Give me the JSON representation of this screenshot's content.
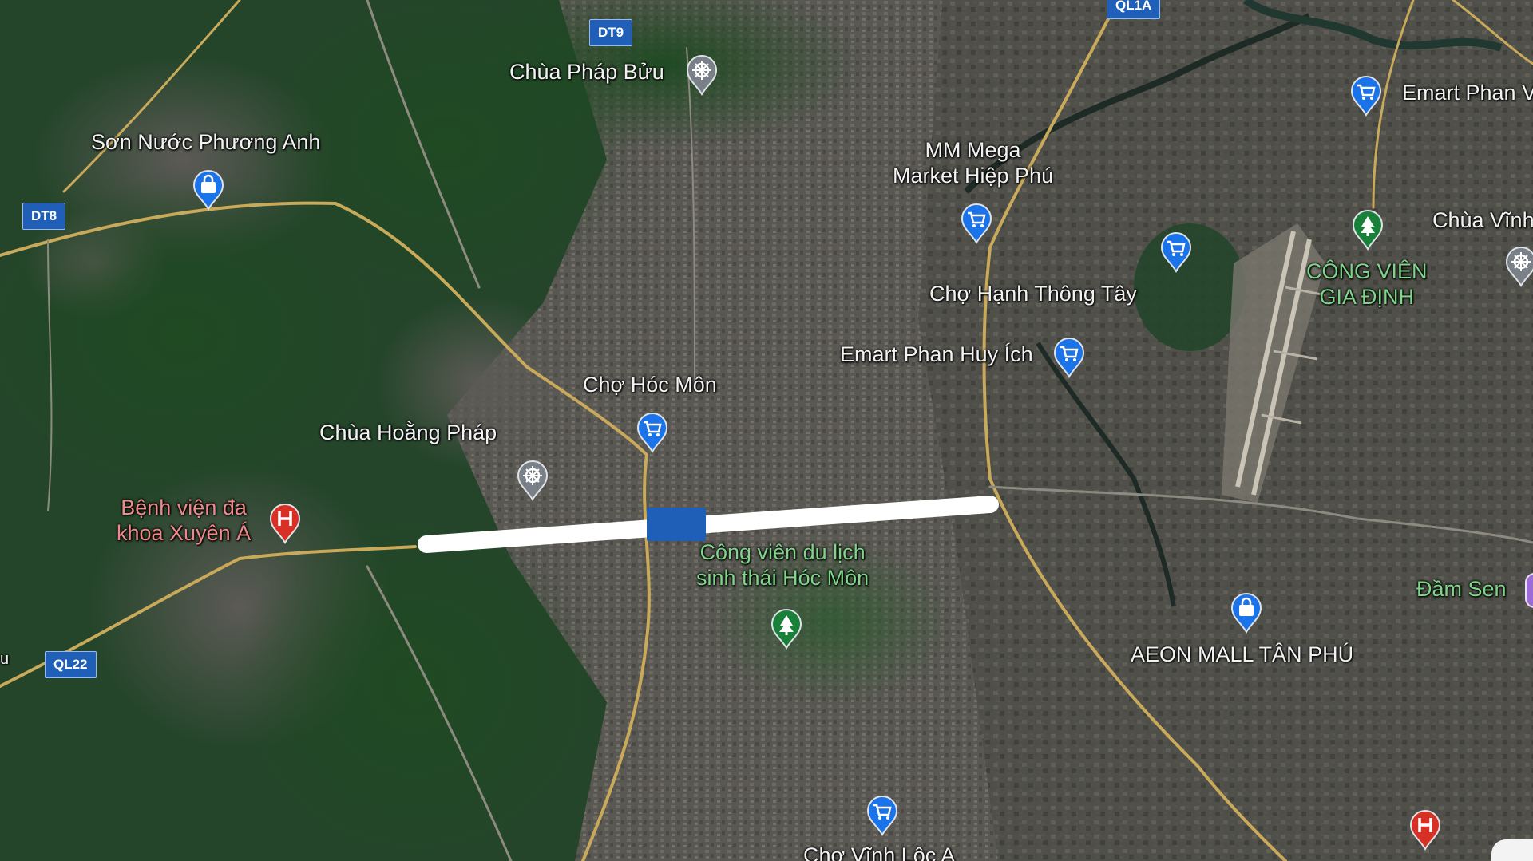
{
  "map": {
    "view": "satellite",
    "accent_colors": {
      "shopping": "#1a73e8",
      "park": "#188038",
      "hospital": "#d93025",
      "worship": "#7a8088",
      "route_highlight": "#ffffff"
    },
    "road_shields": [
      {
        "id": "dt9",
        "label": "DT9"
      },
      {
        "id": "ql1a",
        "label": "QL1A"
      },
      {
        "id": "dt8",
        "label": "DT8"
      },
      {
        "id": "ql22",
        "label": "QL22"
      }
    ],
    "places": [
      {
        "id": "chua-phap-buu",
        "name": "Chùa Pháp Bửu",
        "icon": "worship-icon"
      },
      {
        "id": "son-nuoc-phuong-anh",
        "name": "Sơn Nước Phương Anh",
        "icon": "shopping-bag-icon"
      },
      {
        "id": "mm-mega",
        "name": "MM Mega\nMarket Hiệp Phú",
        "icon": "shopping-cart-icon"
      },
      {
        "id": "emart-phan-v",
        "name": "Emart Phan V",
        "icon": "shopping-cart-icon"
      },
      {
        "id": "chua-vinh",
        "name": "Chùa Vĩnh",
        "icon": "worship-icon"
      },
      {
        "id": "cong-vien-gia-dinh",
        "name": "CÔNG VIÊN\nGIA ĐỊNH",
        "icon": "park-icon"
      },
      {
        "id": "cho-hanh-thong-tay",
        "name": "Chợ Hạnh Thông Tây",
        "icon": "shopping-cart-icon"
      },
      {
        "id": "emart-phan-huy-ich",
        "name": "Emart Phan Huy Ích",
        "icon": "shopping-cart-icon"
      },
      {
        "id": "cho-hoc-mon",
        "name": "Chợ Hóc Môn",
        "icon": "shopping-cart-icon"
      },
      {
        "id": "chua-hoang-phap",
        "name": "Chùa Hoằng Pháp",
        "icon": "worship-icon"
      },
      {
        "id": "benh-vien-xuyen-a",
        "name": "Bệnh viện đa\nkhoa Xuyên Á",
        "icon": "hospital-icon"
      },
      {
        "id": "cong-vien-hoc-mon",
        "name": "Công viên du lịch\nsinh thái Hóc Môn",
        "icon": "park-icon"
      },
      {
        "id": "dam-sen",
        "name": "Đầm Sen",
        "icon": "park-icon"
      },
      {
        "id": "aeon-mall",
        "name": "AEON MALL TÂN PHÚ",
        "icon": "shopping-bag-icon"
      },
      {
        "id": "cho-vinh-loc-a",
        "name": "Chợ Vĩnh Lộc A",
        "icon": "shopping-cart-icon"
      },
      {
        "id": "hospital-se",
        "name": "",
        "icon": "hospital-icon"
      },
      {
        "id": "cart-extra",
        "name": "",
        "icon": "shopping-cart-icon"
      }
    ],
    "edge_text": {
      "left": "u"
    }
  }
}
